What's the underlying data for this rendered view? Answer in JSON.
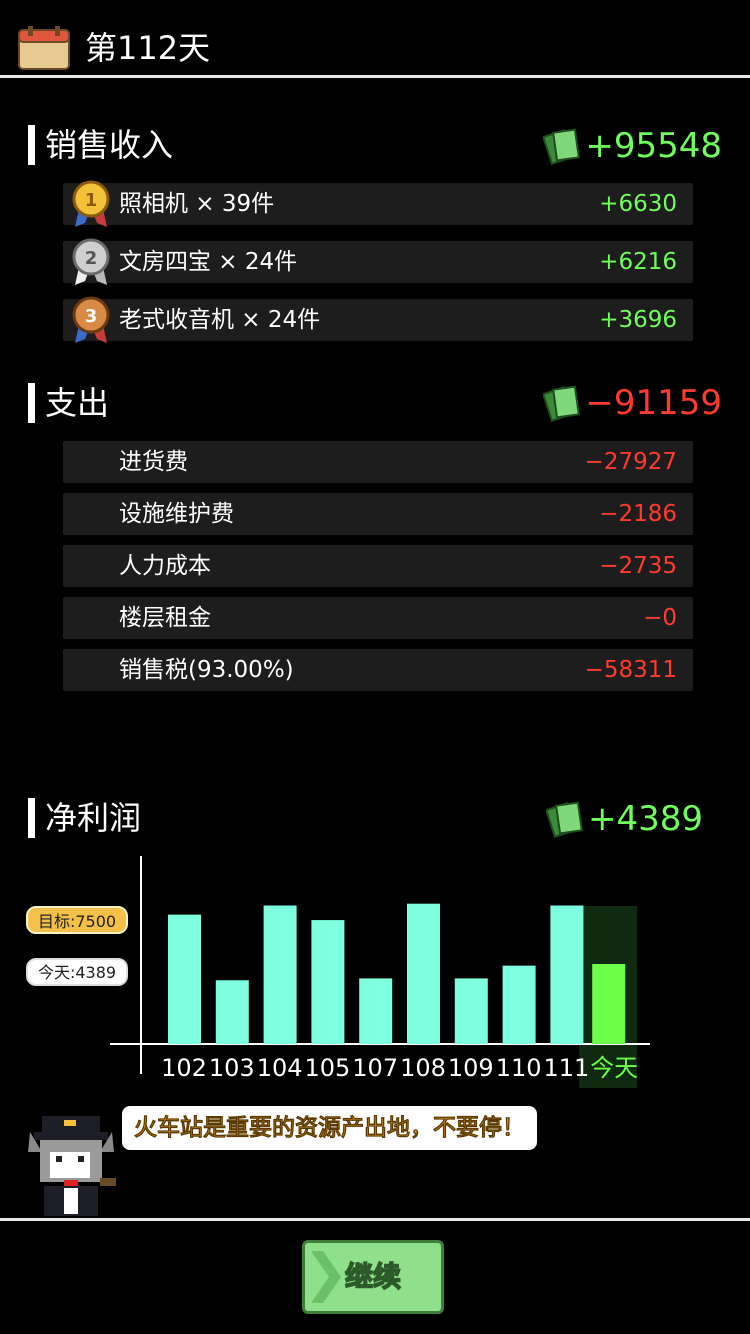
{
  "header": {
    "title": "第112天"
  },
  "revenue": {
    "title": "销售收入",
    "total": "+95548",
    "items": [
      {
        "rank": "1",
        "label": "照相机 × 39件",
        "value": "+6630"
      },
      {
        "rank": "2",
        "label": "文房四宝 × 24件",
        "value": "+6216"
      },
      {
        "rank": "3",
        "label": "老式收音机 × 24件",
        "value": "+3696"
      }
    ]
  },
  "expense": {
    "title": "支出",
    "total": "−91159",
    "items": [
      {
        "label": "进货费",
        "value": "−27927"
      },
      {
        "label": "设施维护费",
        "value": "−2186"
      },
      {
        "label": "人力成本",
        "value": "−2735"
      },
      {
        "label": "楼层租金",
        "value": "−0"
      },
      {
        "label": "销售税(93.00%)",
        "value": "−58311"
      }
    ]
  },
  "profit": {
    "title": "净利润",
    "total": "+4389"
  },
  "chart_data": {
    "type": "bar",
    "categories": [
      "102",
      "103",
      "104",
      "105",
      "107",
      "108",
      "109",
      "110",
      "111",
      "今天"
    ],
    "values": [
      7100,
      3500,
      7600,
      6800,
      3600,
      7700,
      3600,
      4300,
      7600,
      4389
    ],
    "ylim": [
      0,
      9000
    ],
    "target_label": "目标:7500",
    "today_label": "今天:4389",
    "colors": {
      "bar": "#7effe0",
      "today_bar": "#6bff47",
      "today_bg": "#0f2a10",
      "axis": "#ffffff"
    }
  },
  "tip": {
    "text": "火车站是重要的资源产出地，不要停！"
  },
  "continue_button": {
    "label": "继续"
  }
}
